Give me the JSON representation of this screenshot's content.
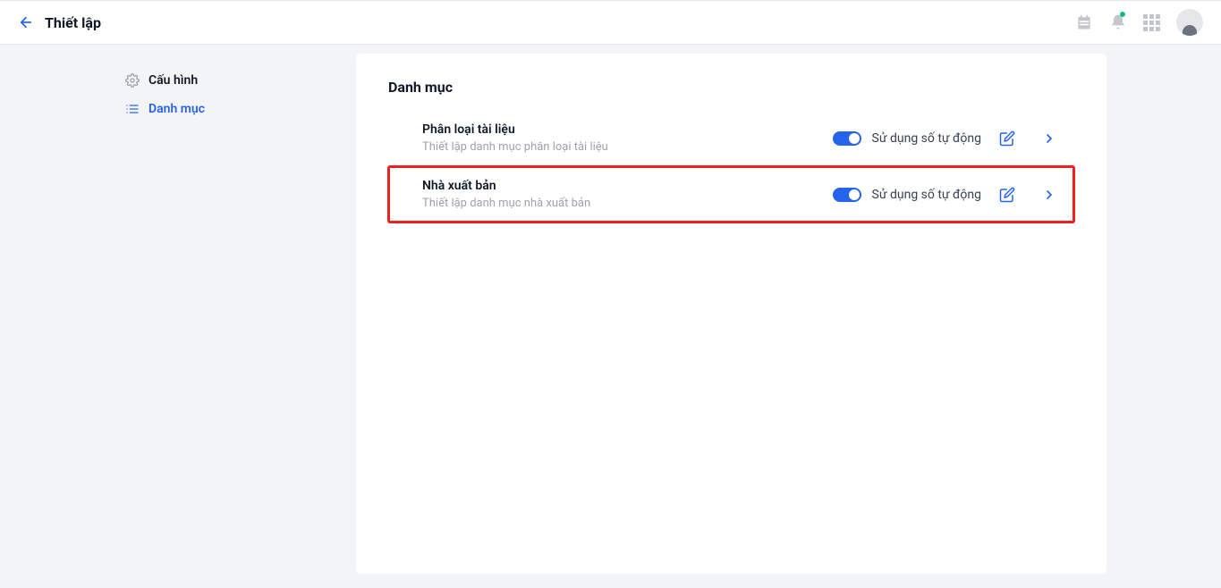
{
  "header": {
    "title": "Thiết lập"
  },
  "sidebar": {
    "items": [
      {
        "label": "Cấu hình",
        "active": false
      },
      {
        "label": "Danh mục",
        "active": true
      }
    ]
  },
  "main": {
    "section_title": "Danh mục",
    "toggle_label": "Sử dụng số tự động",
    "rows": [
      {
        "title": "Phân loại tài liệu",
        "description": "Thiết lập danh mục phân loại tài liệu",
        "highlighted": false
      },
      {
        "title": "Nhà xuất bản",
        "description": "Thiết lập danh mục nhà xuất bản",
        "highlighted": true
      }
    ]
  }
}
